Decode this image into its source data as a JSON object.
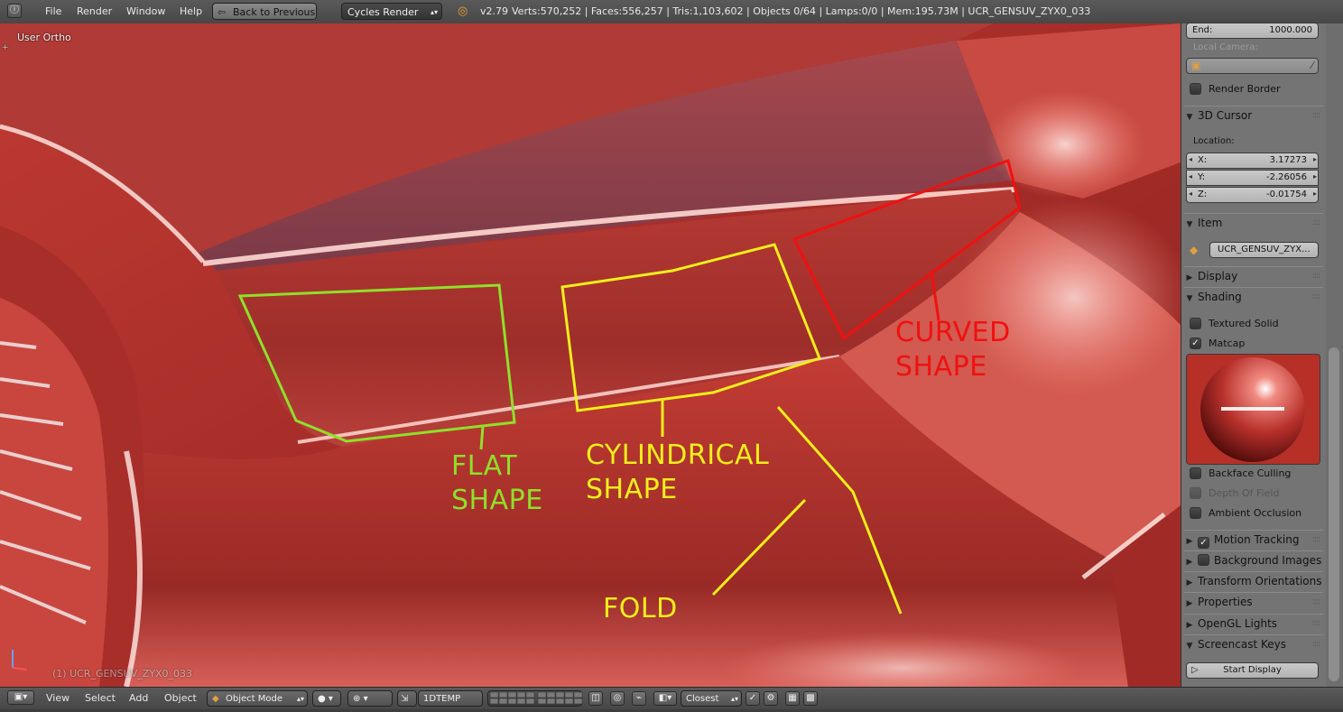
{
  "topbar": {
    "menu": [
      "File",
      "Render",
      "Window",
      "Help"
    ],
    "back_button": "Back to Previous",
    "render_engine": "Cycles Render",
    "version": "v2.79",
    "stats": "Verts:570,252 | Faces:556,257 | Tris:1,103,602 | Objects 0/64 | Lamps:0/0 | Mem:195.73M | UCR_GENSUV_ZYX0_033"
  },
  "viewport": {
    "view_label": "User Ortho",
    "object_label": "(1) UCR_GENSUV_ZYX0_033",
    "annotations": {
      "flat": [
        "FLAT",
        "SHAPE"
      ],
      "cylindrical": [
        "CYLINDRICAL",
        "SHAPE"
      ],
      "curved": [
        "CURVED",
        "SHAPE"
      ],
      "fold": "FOLD"
    },
    "colors": {
      "flat": "#8fe02a",
      "cylindrical": "#f2ee1c",
      "curved": "#f01010",
      "fold": "#f2ee1c",
      "paint": "#b8302c"
    }
  },
  "sidebar": {
    "end_label": "End:",
    "end_value": "1000.000",
    "local_camera_label": "Local Camera:",
    "render_border_label": "Render Border",
    "cursor_panel": "3D Cursor",
    "location_label": "Location:",
    "loc": [
      {
        "axis": "X:",
        "value": "3.17273"
      },
      {
        "axis": "Y:",
        "value": "-2.26056"
      },
      {
        "axis": "Z:",
        "value": "-0.01754"
      }
    ],
    "item_panel": "Item",
    "item_name": "UCR_GENSUV_ZYX...",
    "display_panel": "Display",
    "shading_panel": "Shading",
    "textured_solid_label": "Textured Solid",
    "matcap_label": "Matcap",
    "backface_label": "Backface Culling",
    "dof_label": "Depth Of Field",
    "ao_label": "Ambient Occlusion",
    "motion_tracking": "Motion Tracking",
    "background_images": "Background Images",
    "transform_orientations": "Transform Orientations",
    "properties": "Properties",
    "opengl_lights": "OpenGL Lights",
    "screencast_keys": "Screencast Keys",
    "start_display": "Start Display",
    "matcap_checked": true,
    "motion_tracking_checked": true
  },
  "bottombar": {
    "menu": [
      "View",
      "Select",
      "Add",
      "Object"
    ],
    "mode": "Object Mode",
    "layer_name": "1DTEMP",
    "snap": "Closest"
  }
}
